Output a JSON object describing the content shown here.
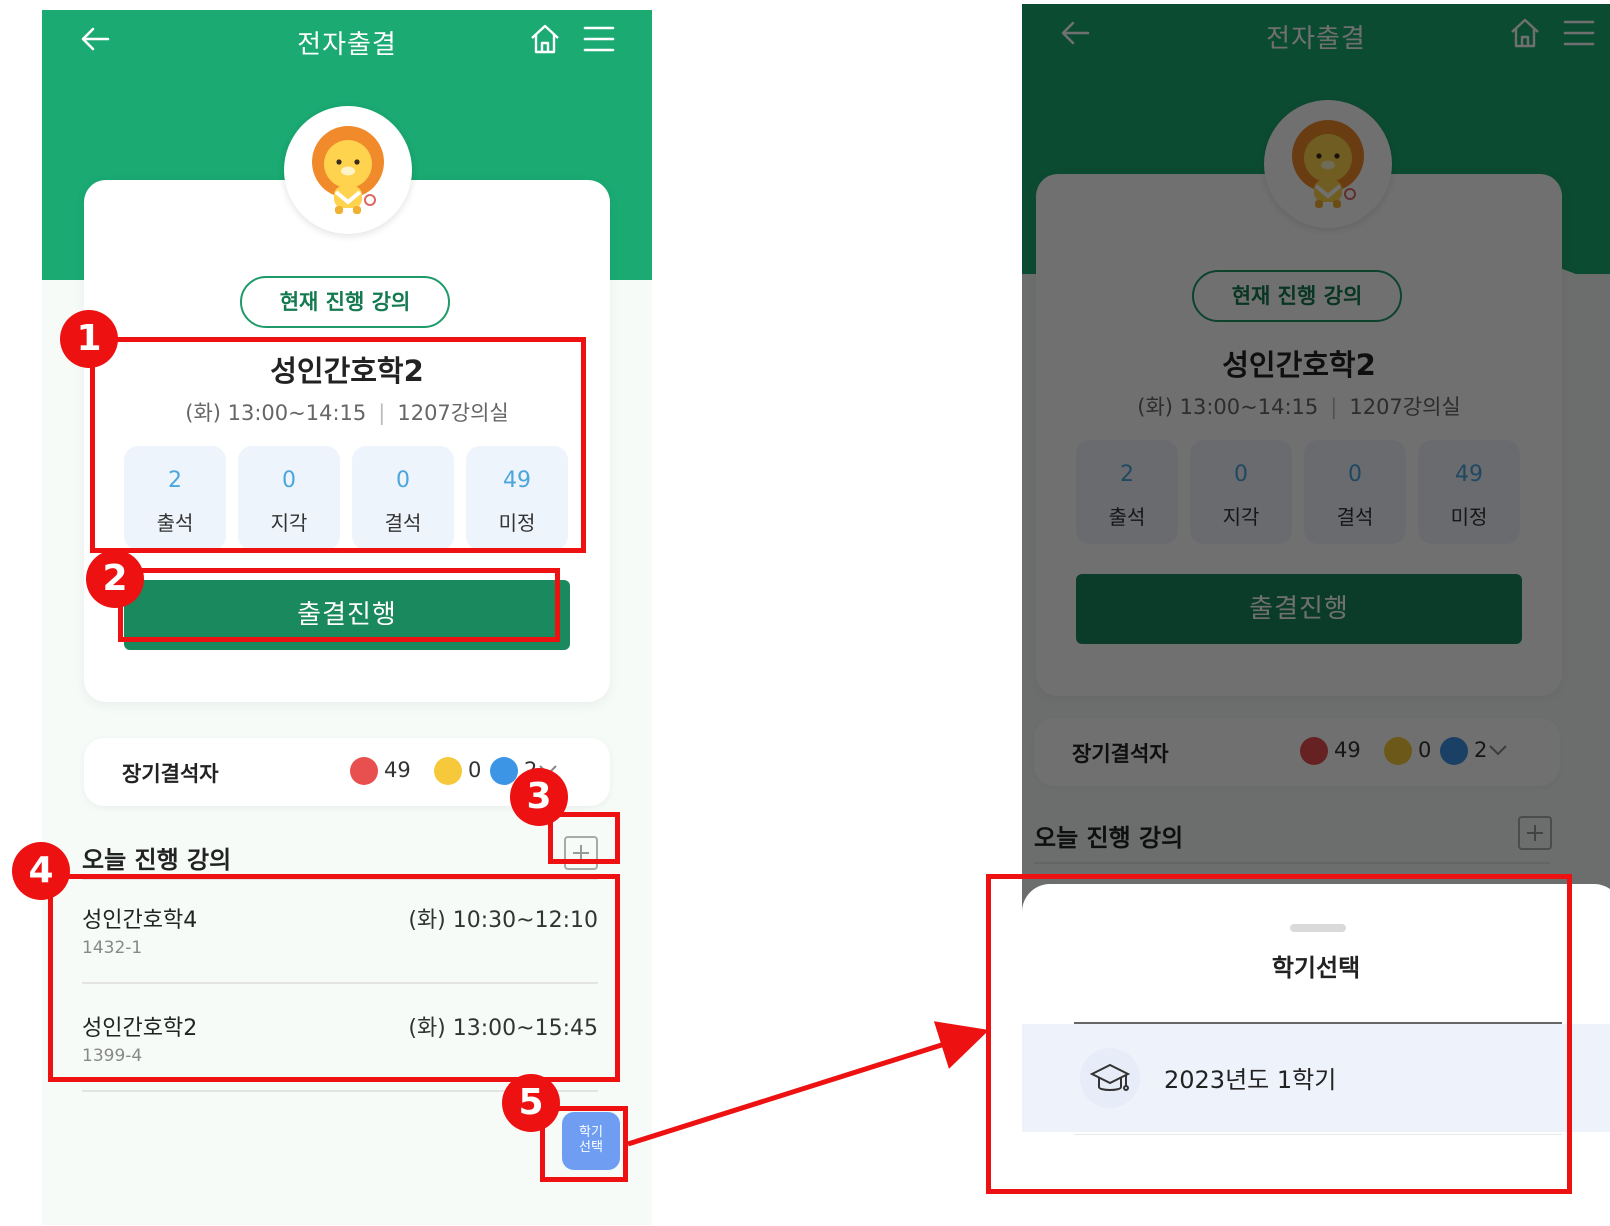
{
  "app": {
    "title": "전자출결"
  },
  "current_lecture": {
    "chip_label": "현재 진행 강의",
    "course_name": "성인간호학2",
    "schedule": "(화) 13:00~14:15",
    "room": "1207강의실",
    "stats": [
      {
        "value": "2",
        "label": "출석"
      },
      {
        "value": "0",
        "label": "지각"
      },
      {
        "value": "0",
        "label": "결석"
      },
      {
        "value": "49",
        "label": "미정"
      }
    ],
    "attend_button": "출결진행"
  },
  "absentee": {
    "label": "장기결석자",
    "counts": [
      {
        "color": "#e84f4f",
        "value": "49"
      },
      {
        "color": "#f6c93a",
        "value": "0"
      },
      {
        "color": "#3d95e6",
        "value": "2"
      }
    ]
  },
  "today": {
    "title": "오늘 진행 강의",
    "lectures": [
      {
        "name": "성인간호학4",
        "room": "1432-1",
        "time": "(화) 10:30~12:10"
      },
      {
        "name": "성인간호학2",
        "room": "1399-4",
        "time": "(화) 13:00~15:45"
      }
    ]
  },
  "fab": {
    "line1": "학기",
    "line2": "선택"
  },
  "semester_sheet": {
    "title": "학기선택",
    "options": [
      "2023년도 1학기"
    ]
  },
  "annotations": [
    "1",
    "2",
    "3",
    "4",
    "5"
  ],
  "colors": {
    "header_green": "#1aaa72",
    "button_green": "#1a8a5e",
    "annotation_red": "#ee1111",
    "fab_blue": "#6e9df2"
  }
}
